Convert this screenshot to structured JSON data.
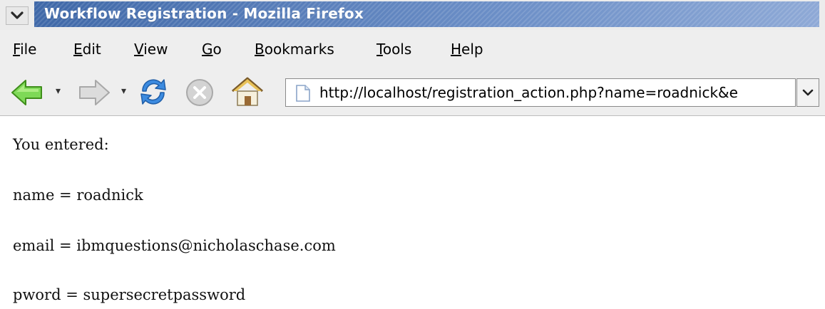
{
  "window": {
    "title": "Workflow Registration - Mozilla Firefox"
  },
  "menu": {
    "items": [
      {
        "label": "File",
        "accel": "F",
        "rest": "ile"
      },
      {
        "label": "Edit",
        "accel": "E",
        "rest": "dit"
      },
      {
        "label": "View",
        "accel": "V",
        "rest": "iew"
      },
      {
        "label": "Go",
        "accel": "G",
        "rest": "o"
      },
      {
        "label": "Bookmarks",
        "accel": "B",
        "rest": "ookmarks"
      },
      {
        "label": "Tools",
        "accel": "T",
        "rest": "ools"
      },
      {
        "label": "Help",
        "accel": "H",
        "rest": "elp"
      }
    ]
  },
  "toolbar": {
    "icons": [
      "back-arrow-icon",
      "forward-arrow-icon",
      "reload-icon",
      "stop-icon",
      "home-icon"
    ],
    "url": "http://localhost/registration_action.php?name=roadnick&e"
  },
  "page": {
    "heading": "You entered:",
    "lines": [
      "name = roadnick",
      "email = ibmquestions@nicholaschase.com",
      "pword = supersecretpassword"
    ]
  },
  "colors": {
    "titlebar_accent": "#3f68a8",
    "back_arrow": "#5cc02c",
    "reload": "#2f7bd6"
  }
}
